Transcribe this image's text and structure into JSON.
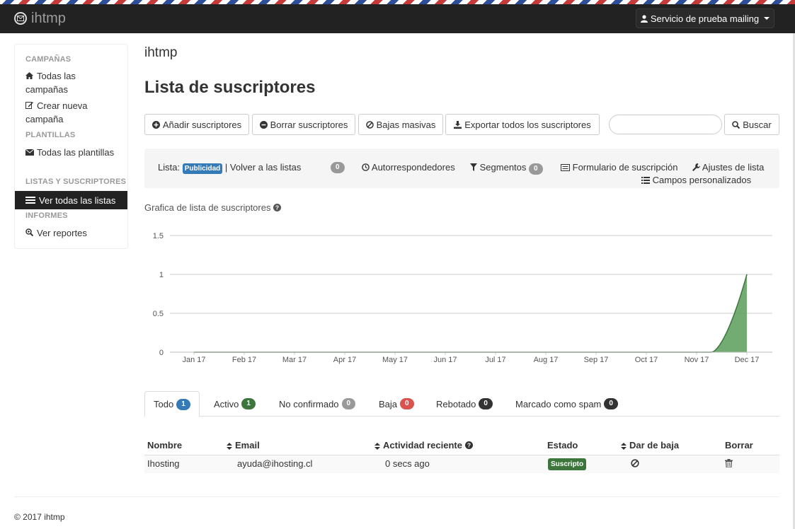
{
  "navbar": {
    "brand": "ihtmp",
    "account_label": "Servicio de prueba mailing"
  },
  "sidebar": {
    "sections": [
      {
        "heading": "CAMPAÑAS",
        "items": [
          "Todas las campañas",
          "Crear nueva campaña"
        ]
      },
      {
        "heading": "PLANTILLAS",
        "items": [
          "Todas las plantillas"
        ]
      },
      {
        "heading": "LISTAS Y SUSCRIPTORES",
        "items": [
          "Ver todas las listas"
        ]
      },
      {
        "heading": "INFORMES",
        "items": [
          "Ver reportes"
        ]
      }
    ],
    "active_item": "Ver todas las listas"
  },
  "main": {
    "app_title": "ihtmp",
    "page_title": "Lista de suscriptores",
    "actions": {
      "add": "Añadir suscriptores",
      "delete": "Borrar suscriptores",
      "unsubscribe": "Bajas masivas",
      "export": "Exportar todos los suscriptores",
      "search_value": "",
      "search_button": "Buscar"
    },
    "listbar": {
      "list_label": "Lista:",
      "list_name": "Publicidad",
      "separator": "|",
      "back_link": "Volver a las listas",
      "count_badge": "0",
      "autoresponders": "Autorrespondedores",
      "segments": "Segmentos",
      "segments_count": "0",
      "subscribe_form": "Formulario de suscripción",
      "list_settings": "Ajustes de lista",
      "custom_fields": "Campos personalizados"
    },
    "chart_heading": "Grafica de lista de suscriptores",
    "tabs": [
      {
        "label": "Todo",
        "count": "1"
      },
      {
        "label": "Activo",
        "count": "1"
      },
      {
        "label": "No confirmado",
        "count": "0"
      },
      {
        "label": "Baja",
        "count": "0"
      },
      {
        "label": "Rebotado",
        "count": "0"
      },
      {
        "label": "Marcado como spam",
        "count": "0"
      }
    ],
    "table": {
      "headers": [
        "Nombre",
        "Email",
        "Actividad reciente",
        "Estado",
        "Dar de baja",
        "Borrar"
      ],
      "rows": [
        {
          "name": "Ihosting",
          "email": "ayuda@ihosting.cl",
          "activity": "0 secs ago",
          "status": "Suscripto"
        }
      ]
    }
  },
  "footer": {
    "text": "© 2017 ihtmp"
  },
  "colors": {
    "navbar": "#222222",
    "chart_fill": "#5a9e5a",
    "badge_blue": "#337ab7",
    "badge_green": "#3c763d",
    "badge_red": "#d9534f"
  },
  "chart_data": {
    "type": "area",
    "x": [
      "Jan 17",
      "Feb 17",
      "Mar 17",
      "Apr 17",
      "May 17",
      "Jun 17",
      "Jul 17",
      "Aug 17",
      "Sep 17",
      "Oct 17",
      "Nov 17",
      "Dec 17"
    ],
    "y_ticks": [
      "0",
      "0.5",
      "1",
      "1.5"
    ],
    "ylim": [
      0,
      1.5
    ],
    "series": [
      {
        "values": [
          0,
          0,
          0,
          0,
          0,
          0,
          0,
          0,
          0,
          0,
          0,
          1
        ]
      }
    ],
    "grid": true
  }
}
